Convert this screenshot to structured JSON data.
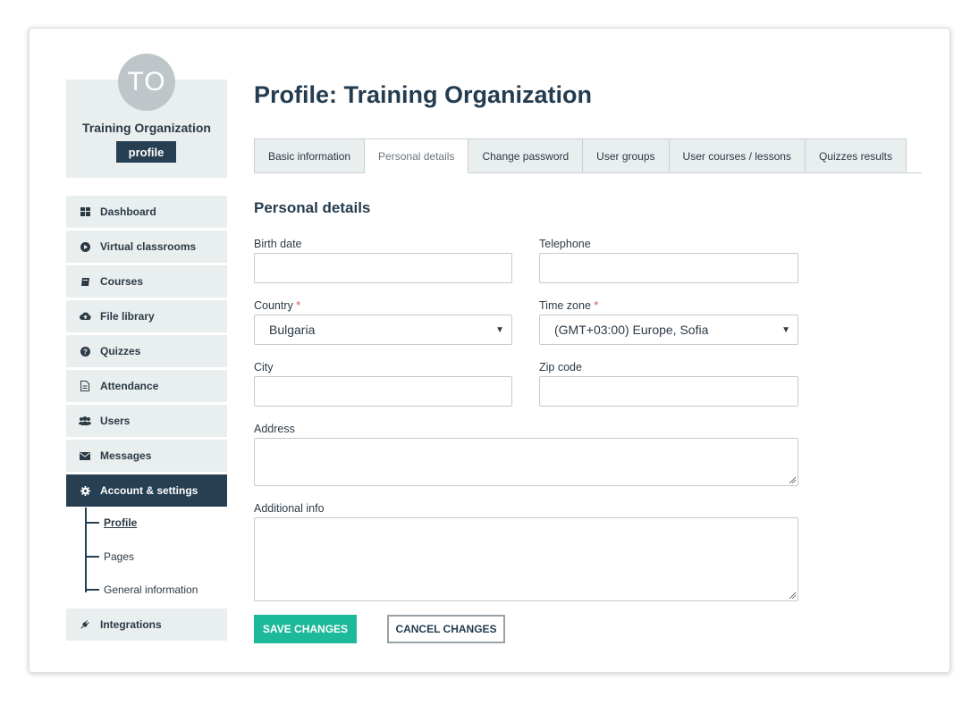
{
  "profile": {
    "avatar_initials": "TO",
    "org_name": "Training Organization",
    "badge": "profile"
  },
  "sidebar": {
    "items": [
      {
        "label": "Dashboard",
        "icon": "dashboard-icon"
      },
      {
        "label": "Virtual classrooms",
        "icon": "play-circle-icon"
      },
      {
        "label": "Courses",
        "icon": "book-icon"
      },
      {
        "label": "File library",
        "icon": "cloud-upload-icon"
      },
      {
        "label": "Quizzes",
        "icon": "question-circle-icon"
      },
      {
        "label": "Attendance",
        "icon": "document-icon"
      },
      {
        "label": "Users",
        "icon": "users-icon"
      },
      {
        "label": "Messages",
        "icon": "envelope-icon"
      },
      {
        "label": "Account & settings",
        "icon": "gear-icon",
        "active": true
      },
      {
        "label": "Integrations",
        "icon": "plug-icon"
      }
    ],
    "sub_items": [
      {
        "label": "Profile",
        "current": true
      },
      {
        "label": "Pages"
      },
      {
        "label": "General information"
      }
    ]
  },
  "main": {
    "title": "Profile: Training Organization",
    "tabs": [
      {
        "label": "Basic information"
      },
      {
        "label": "Personal details",
        "active": true
      },
      {
        "label": "Change password"
      },
      {
        "label": "User groups"
      },
      {
        "label": "User courses / lessons"
      },
      {
        "label": "Quizzes results"
      }
    ],
    "section_title": "Personal details",
    "form": {
      "birth_date": {
        "label": "Birth date",
        "value": ""
      },
      "telephone": {
        "label": "Telephone",
        "value": ""
      },
      "country": {
        "label": "Country",
        "required_mark": "*",
        "value": "Bulgaria"
      },
      "time_zone": {
        "label": "Time zone",
        "required_mark": "*",
        "value": "(GMT+03:00) Europe, Sofia"
      },
      "city": {
        "label": "City",
        "value": ""
      },
      "zip_code": {
        "label": "Zip code",
        "value": ""
      },
      "address": {
        "label": "Address",
        "value": ""
      },
      "additional_info": {
        "label": "Additional info",
        "value": ""
      }
    },
    "buttons": {
      "save": "SAVE CHANGES",
      "cancel": "CANCEL CHANGES"
    }
  },
  "colors": {
    "accent": "#1cb99a",
    "nav_active": "#263f52",
    "nav_bg": "#e9eeef",
    "required": "#d9534f"
  }
}
